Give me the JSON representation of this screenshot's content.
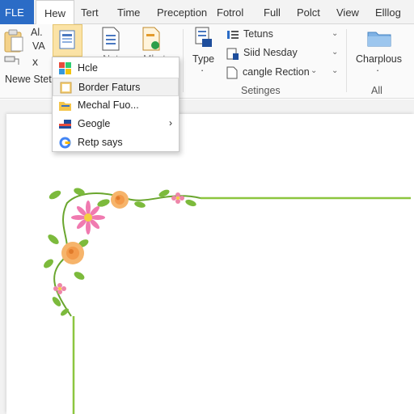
{
  "tabs": {
    "file": "FLE",
    "home": "Hew",
    "insert": "Tert",
    "time": "Time",
    "reception": "Preception",
    "format": "Fotrol",
    "full": "Full",
    "policy": "Polct",
    "view": "View",
    "ellog": "Elllog"
  },
  "ribbon": {
    "font_a": "Al.",
    "font_va": "VA",
    "font_x": "x",
    "new_sheet": "Newe Stet",
    "partial_label_1": "Nat",
    "partial_label_2": "Mlrot",
    "type_label": "Type",
    "returns": "Tetuns",
    "sid_nesday": "Siid Nesday",
    "cangle_rection": "cangle Rection",
    "settings_group": "Setinges",
    "charplous": "Charplous",
    "all_group": "All",
    "dot": "·"
  },
  "menu": {
    "items": [
      {
        "label": "Hcle"
      },
      {
        "label": "Border Faturs"
      },
      {
        "label": "Mechal Fuo..."
      },
      {
        "label": "Geogle"
      },
      {
        "label": "Retp says"
      }
    ]
  },
  "colors": {
    "file_tab": "#2b6cc6",
    "border_vine": "#8cc63f",
    "highlight_button": "#fbe3a6"
  }
}
